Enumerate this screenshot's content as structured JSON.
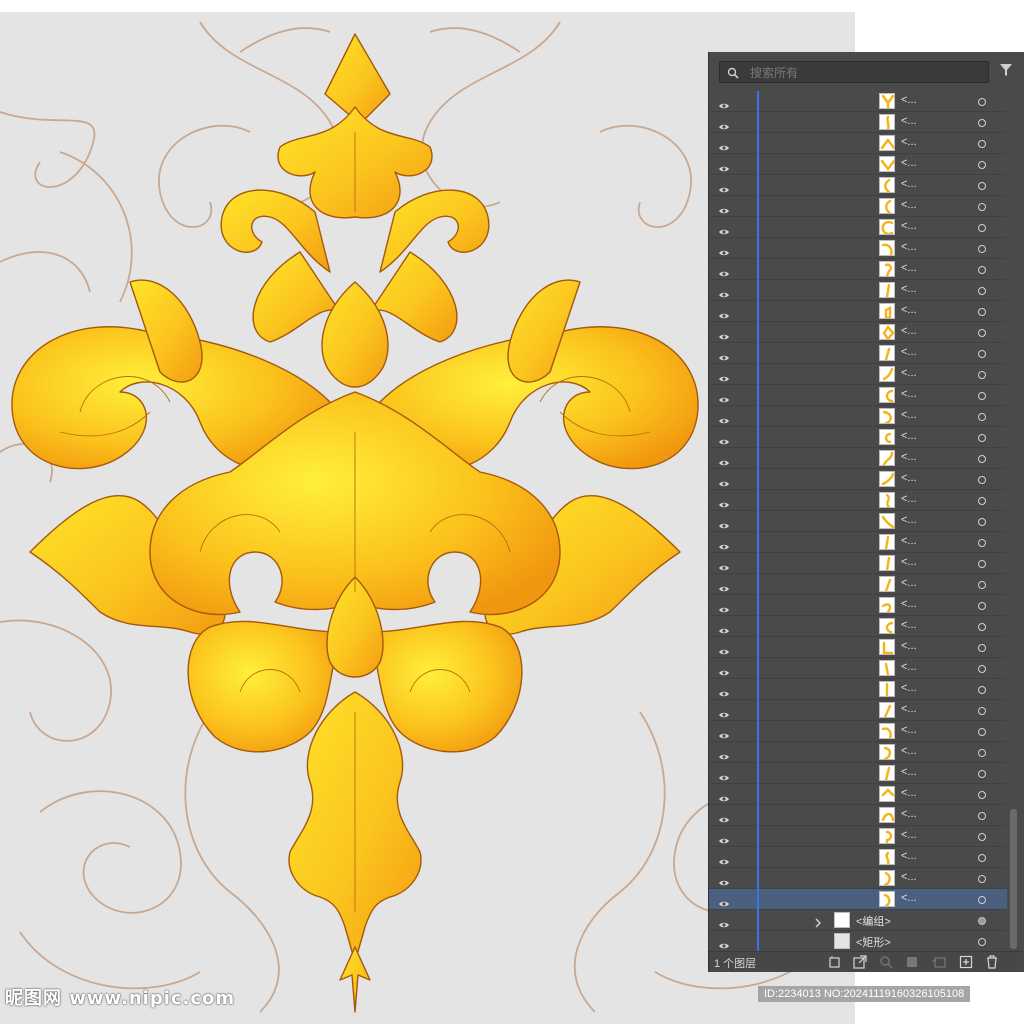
{
  "search": {
    "placeholder": "搜索所有"
  },
  "layers": {
    "path_item_label": "<...",
    "group_label": "<编组>",
    "rect_label": "<矩形>",
    "footer_count": "1 个图层"
  },
  "watermark": {
    "logo_text": "昵图网 www.nipic.com",
    "id_text": "ID:2234013 NO:20241119160326105108"
  },
  "colors": {
    "canvas_bg": "#e4e4e4",
    "ornament_gold": "#f8b81a",
    "ornament_light": "#ffdf2c",
    "outline_tan": "#c7a58d",
    "panel_bg": "#4a4a4a",
    "layer_color": "#3b72e8",
    "selected_row": "#4b5f7e"
  },
  "icons": [
    "search-icon",
    "filter-icon",
    "eye-icon",
    "expand-arrow-icon",
    "target-circle-icon",
    "collect-export-icon",
    "locate-icon",
    "search-layer-icon",
    "clipping-mask-icon",
    "new-sublayer-icon",
    "new-layer-icon",
    "trash-icon"
  ]
}
